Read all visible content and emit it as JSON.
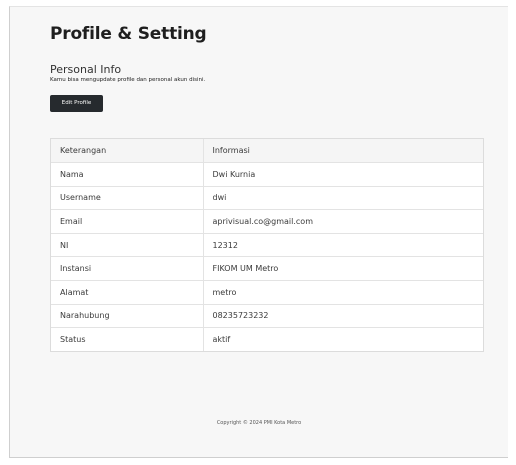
{
  "page": {
    "title": "Profile & Setting"
  },
  "personal_info": {
    "title": "Personal Info",
    "description": "Kamu bisa mengupdate profile dan personal akun disini.",
    "edit_button": "Edit Profile"
  },
  "table": {
    "headers": [
      "Keterangan",
      "Informasi"
    ],
    "rows": [
      [
        "Nama",
        "Dwi Kurnia"
      ],
      [
        "Username",
        "dwi"
      ],
      [
        "Email",
        "aprivisual.co@gmail.com"
      ],
      [
        "NI",
        "12312"
      ],
      [
        "Instansi",
        "FIKOM UM Metro"
      ],
      [
        "Alamat",
        "metro"
      ],
      [
        "Narahubung",
        "08235723232"
      ],
      [
        "Status",
        "aktif"
      ]
    ]
  },
  "footer": {
    "copyright": "Copyright © 2024 PMI Kota Metro"
  }
}
